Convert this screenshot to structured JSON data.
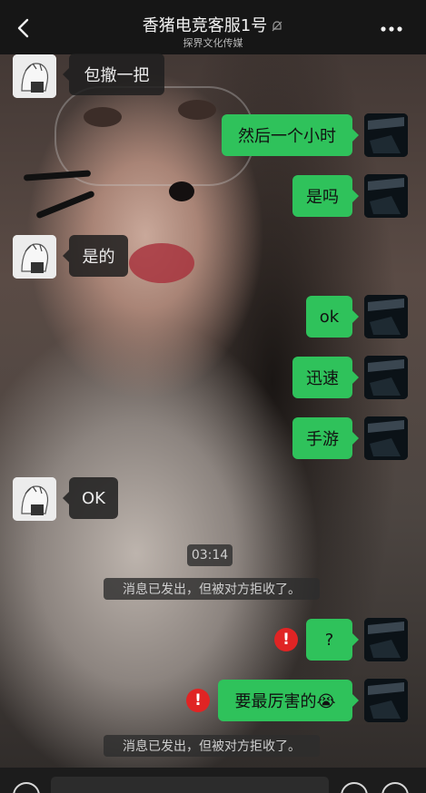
{
  "header": {
    "title": "香猪电竞客服1号",
    "subtitle": "探界文化传媒",
    "back_icon": "chevron-left-icon",
    "mute_icon": "bell-off-icon",
    "more_icon": "more-horizontal-icon"
  },
  "messages": [
    {
      "side": "left",
      "text": "包撤一把"
    },
    {
      "side": "right",
      "text": "然后一个小时"
    },
    {
      "side": "right",
      "text": "是吗"
    },
    {
      "side": "left",
      "text": "是的"
    },
    {
      "side": "right",
      "text": "ok"
    },
    {
      "side": "right",
      "text": "迅速"
    },
    {
      "side": "right",
      "text": "手游"
    },
    {
      "side": "left",
      "text": "OK"
    },
    {
      "side": "right",
      "text": "?",
      "failed": true
    },
    {
      "side": "right",
      "text": "要最厉害的😭",
      "failed": true
    }
  ],
  "timestamp": "03:14",
  "system_notices": [
    "消息已发出，但被对方拒收了。",
    "消息已发出，但被对方拒收了。"
  ],
  "error_icon": "!",
  "colors": {
    "sent_bubble": "#2fc25b",
    "received_bubble": "#1e1e1e",
    "error": "#e02424"
  }
}
